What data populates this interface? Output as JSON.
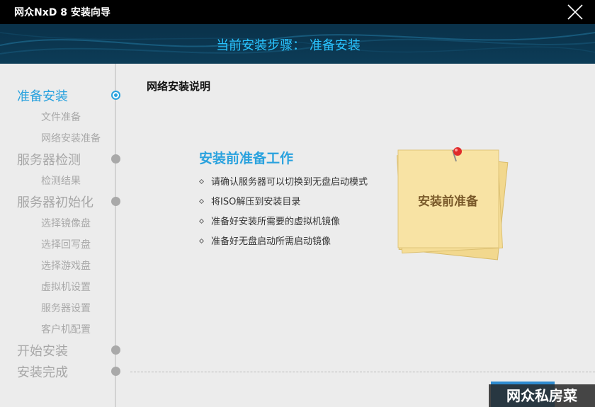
{
  "window": {
    "title": "网众NxD 8 安装向导"
  },
  "header": {
    "step_text": "当前安装步骤： 准备安装"
  },
  "sidebar": {
    "steps": [
      {
        "label": "准备安装",
        "state": "active",
        "subs": [
          "文件准备",
          "网络安装准备"
        ]
      },
      {
        "label": "服务器检测",
        "state": "pending",
        "subs": [
          "检测结果"
        ]
      },
      {
        "label": "服务器初始化",
        "state": "pending",
        "subs": [
          "选择镜像盘",
          "选择回写盘",
          "选择游戏盘",
          "虚拟机设置",
          "服务器设置",
          "客户机配置"
        ]
      },
      {
        "label": "开始安装",
        "state": "pending",
        "subs": []
      },
      {
        "label": "安装完成",
        "state": "pending",
        "subs": []
      }
    ]
  },
  "main": {
    "title": "网络安装说明",
    "prep_title": "安装前准备工作",
    "items": [
      "请确认服务器可以切换到无盘启动模式",
      "将ISO解压到安装目录",
      "准备好安装所需要的虚拟机镜像",
      "准备好无盘启动所需启动镜像"
    ],
    "note_label": "安装前准备"
  },
  "watermark": "网众私房菜",
  "colors": {
    "accent": "#2aa2de",
    "header_bg": "#0c3c57",
    "note": "#f8e3a4"
  }
}
